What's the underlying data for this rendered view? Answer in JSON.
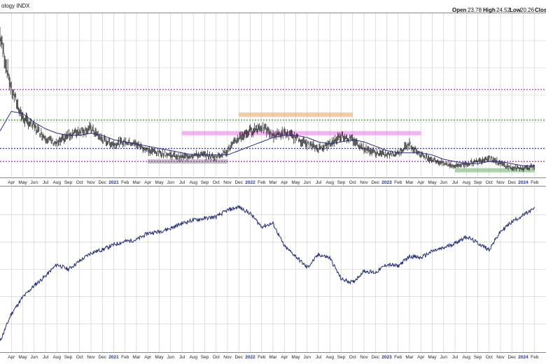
{
  "header": {
    "title": "ology INDX",
    "open_label": "Open",
    "open_value": "23.78",
    "high_label": "High",
    "high_value": "24.52",
    "low_label": "Low",
    "low_value": "20.26",
    "close_label": "Clos"
  },
  "colors": {
    "price": "#111111",
    "ma": "#2b2b8c",
    "index_line": "#1f2a7a",
    "grid": "#c9c9c9",
    "purple_dotted": "#a020c0",
    "green_dotted": "#20a020",
    "blue_dotted": "#2030c0",
    "orange_band": "#f0a050",
    "magenta_band": "#f070f0",
    "gray_band": "#8c8c8c",
    "teal_band": "#60b060",
    "year_label": "#2030c0"
  },
  "chart_data": [
    {
      "type": "candlestick",
      "panel": "upper",
      "xlim": [
        "2020-03",
        "2024-03"
      ],
      "ylim": [
        15,
        90
      ],
      "grid": true,
      "month_labels": [
        "Apr",
        "May",
        "Jun",
        "Jul",
        "Aug",
        "Sep",
        "Oct",
        "Nov",
        "Dec",
        "2021",
        "Feb",
        "Mar",
        "Apr",
        "May",
        "Jun",
        "Jul",
        "Aug",
        "Sep",
        "Oct",
        "Nov",
        "Dec",
        "2022",
        "Feb",
        "Mar",
        "Apr",
        "May",
        "Jun",
        "Jul",
        "Aug",
        "Sep",
        "Oct",
        "Nov",
        "Dec",
        "2023",
        "Feb",
        "Mar",
        "Apr",
        "May",
        "Jun",
        "Jul",
        "Aug",
        "Sep",
        "Oct",
        "Nov",
        "Dec",
        "2024",
        "Feb"
      ],
      "price_series": {
        "x": [
          "2020-03",
          "2020-04",
          "2020-05",
          "2020-06",
          "2020-07",
          "2020-08",
          "2020-09",
          "2020-10",
          "2020-11",
          "2020-12",
          "2021-01",
          "2021-02",
          "2021-03",
          "2021-04",
          "2021-05",
          "2021-06",
          "2021-07",
          "2021-08",
          "2021-09",
          "2021-10",
          "2021-11",
          "2021-12",
          "2022-01",
          "2022-02",
          "2022-03",
          "2022-04",
          "2022-05",
          "2022-06",
          "2022-07",
          "2022-08",
          "2022-09",
          "2022-10",
          "2022-11",
          "2022-12",
          "2023-01",
          "2023-02",
          "2023-03",
          "2023-04",
          "2023-05",
          "2023-06",
          "2023-07",
          "2023-08",
          "2023-09",
          "2023-10",
          "2023-11",
          "2023-12",
          "2024-01",
          "2024-02"
        ],
        "y": [
          80,
          55,
          42,
          38,
          33,
          30,
          34,
          36,
          37,
          32,
          30,
          31,
          30,
          27,
          26,
          25,
          24,
          25,
          25,
          24,
          27,
          33,
          36,
          38,
          34,
          35,
          33,
          30,
          28,
          30,
          34,
          32,
          28,
          26,
          25,
          26,
          30,
          25,
          23,
          21,
          20,
          21,
          22,
          24,
          21,
          19,
          19,
          20
        ]
      },
      "ma_series": {
        "x": [
          "2020-03",
          "2020-04",
          "2020-05",
          "2020-06",
          "2020-07",
          "2020-08",
          "2020-09",
          "2020-10",
          "2020-11",
          "2020-12",
          "2021-01",
          "2021-02",
          "2021-03",
          "2021-04",
          "2021-05",
          "2021-06",
          "2021-07",
          "2021-08",
          "2021-09",
          "2021-10",
          "2021-11",
          "2021-12",
          "2022-01",
          "2022-02",
          "2022-03",
          "2022-04",
          "2022-05",
          "2022-06",
          "2022-07",
          "2022-08",
          "2022-09",
          "2022-10",
          "2022-11",
          "2022-12",
          "2023-01",
          "2023-02",
          "2023-03",
          "2023-04",
          "2023-05",
          "2023-06",
          "2023-07",
          "2023-08",
          "2023-09",
          "2023-10",
          "2023-11",
          "2023-12",
          "2024-01",
          "2024-02"
        ],
        "y": [
          36,
          45,
          44,
          40,
          37,
          35,
          34,
          34,
          35,
          34,
          32,
          31,
          30,
          29,
          28,
          27,
          26,
          25,
          25,
          25,
          25,
          27,
          29,
          31,
          33,
          34,
          34,
          33,
          31,
          30,
          31,
          32,
          31,
          29,
          27,
          26,
          26,
          26,
          25,
          23,
          22,
          21,
          21,
          22,
          22,
          21,
          20,
          20
        ]
      },
      "horizontal_lines": [
        {
          "style": "dotted",
          "color": "purple_dotted",
          "y": 55
        },
        {
          "style": "dotted",
          "color": "green_dotted",
          "y": 41
        },
        {
          "style": "dotted",
          "color": "blue_dotted",
          "y": 28
        },
        {
          "style": "dotted",
          "color": "purple_dotted",
          "y": 22
        }
      ],
      "bands": [
        {
          "color": "orange_band",
          "y": 43.5,
          "x0": "2021-12",
          "x1": "2022-10"
        },
        {
          "color": "magenta_band",
          "y": 35,
          "x0": "2021-07",
          "x1": "2023-04"
        },
        {
          "color": "gray_band",
          "y": 22,
          "x0": "2021-04",
          "x1": "2021-11"
        },
        {
          "color": "teal_band",
          "y": 18,
          "x0": "2023-07",
          "x1": "2024-02"
        }
      ]
    },
    {
      "type": "line",
      "panel": "lower",
      "xlim": [
        "2020-03",
        "2024-03"
      ],
      "ylim": [
        0,
        100
      ],
      "grid": true,
      "month_labels": [
        "Apr",
        "May",
        "Jun",
        "Jul",
        "Aug",
        "Sep",
        "Oct",
        "Nov",
        "Dec",
        "2021",
        "Feb",
        "Mar",
        "Apr",
        "May",
        "Jun",
        "Jul",
        "Aug",
        "Sep",
        "Oct",
        "Nov",
        "Dec",
        "2022",
        "Feb",
        "Mar",
        "Apr",
        "May",
        "Jun",
        "Jul",
        "Aug",
        "Sep",
        "Oct",
        "Nov",
        "Dec",
        "2023",
        "Feb",
        "Mar",
        "Apr",
        "May",
        "Jun",
        "Jul",
        "Aug",
        "Sep",
        "Oct",
        "Nov",
        "Dec",
        "2024",
        "Feb"
      ],
      "series": [
        {
          "x": [
            "2020-03",
            "2020-04",
            "2020-05",
            "2020-06",
            "2020-07",
            "2020-08",
            "2020-09",
            "2020-10",
            "2020-11",
            "2020-12",
            "2021-01",
            "2021-02",
            "2021-03",
            "2021-04",
            "2021-05",
            "2021-06",
            "2021-07",
            "2021-08",
            "2021-09",
            "2021-10",
            "2021-11",
            "2021-12",
            "2022-01",
            "2022-02",
            "2022-03",
            "2022-04",
            "2022-05",
            "2022-06",
            "2022-07",
            "2022-08",
            "2022-09",
            "2022-10",
            "2022-11",
            "2022-12",
            "2023-01",
            "2023-02",
            "2023-03",
            "2023-04",
            "2023-05",
            "2023-06",
            "2023-07",
            "2023-08",
            "2023-09",
            "2023-10",
            "2023-11",
            "2023-12",
            "2024-01",
            "2024-02"
          ],
          "y": [
            6,
            23,
            33,
            40,
            46,
            53,
            50,
            55,
            60,
            62,
            65,
            67,
            68,
            72,
            73,
            75,
            78,
            80,
            81,
            82,
            86,
            88,
            84,
            76,
            78,
            64,
            58,
            51,
            59,
            57,
            44,
            42,
            49,
            48,
            53,
            52,
            58,
            57,
            61,
            63,
            66,
            70,
            66,
            62,
            73,
            79,
            83,
            87
          ]
        }
      ]
    }
  ]
}
